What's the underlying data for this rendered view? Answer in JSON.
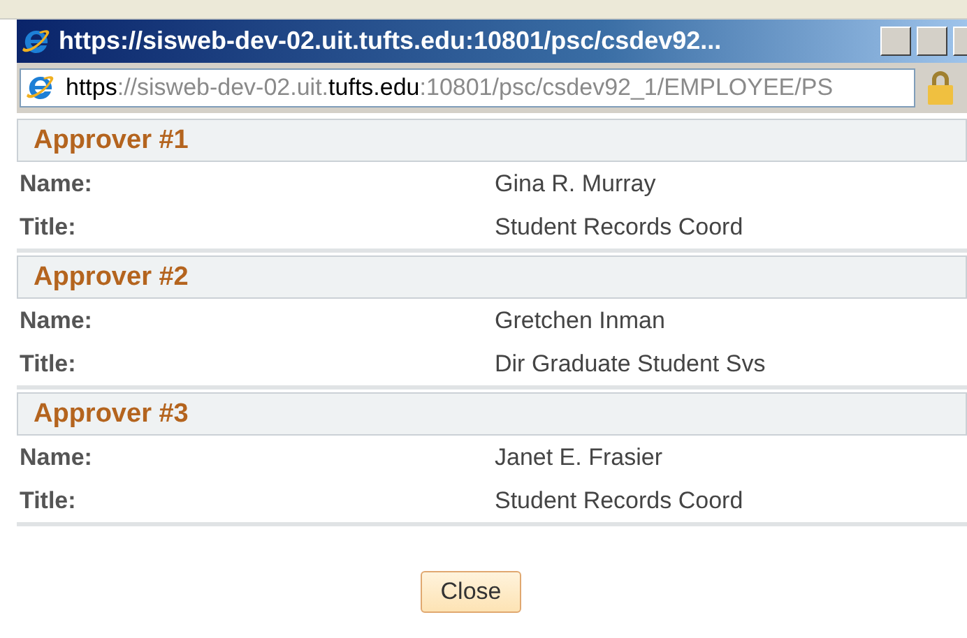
{
  "window": {
    "title": "https://sisweb-dev-02.uit.tufts.edu:10801/psc/csdev92..."
  },
  "address_bar": {
    "segments": [
      {
        "text": "https",
        "emphasis": true
      },
      {
        "text": "://sisweb-dev-02.uit.",
        "emphasis": false
      },
      {
        "text": "tufts.edu",
        "emphasis": true
      },
      {
        "text": ":10801/psc/csdev92_1/EMPLOYEE/PS",
        "emphasis": false
      }
    ]
  },
  "approvers": [
    {
      "heading": "Approver #1",
      "fields": [
        {
          "label": "Name:",
          "value": "Gina R. Murray"
        },
        {
          "label": "Title:",
          "value": "Student Records Coord"
        }
      ]
    },
    {
      "heading": "Approver #2",
      "fields": [
        {
          "label": "Name:",
          "value": "Gretchen Inman"
        },
        {
          "label": "Title:",
          "value": "Dir Graduate Student Svs"
        }
      ]
    },
    {
      "heading": "Approver #3",
      "fields": [
        {
          "label": "Name:",
          "value": "Janet E. Frasier"
        },
        {
          "label": "Title:",
          "value": "Student Records Coord"
        }
      ]
    }
  ],
  "buttons": [
    "Close"
  ]
}
